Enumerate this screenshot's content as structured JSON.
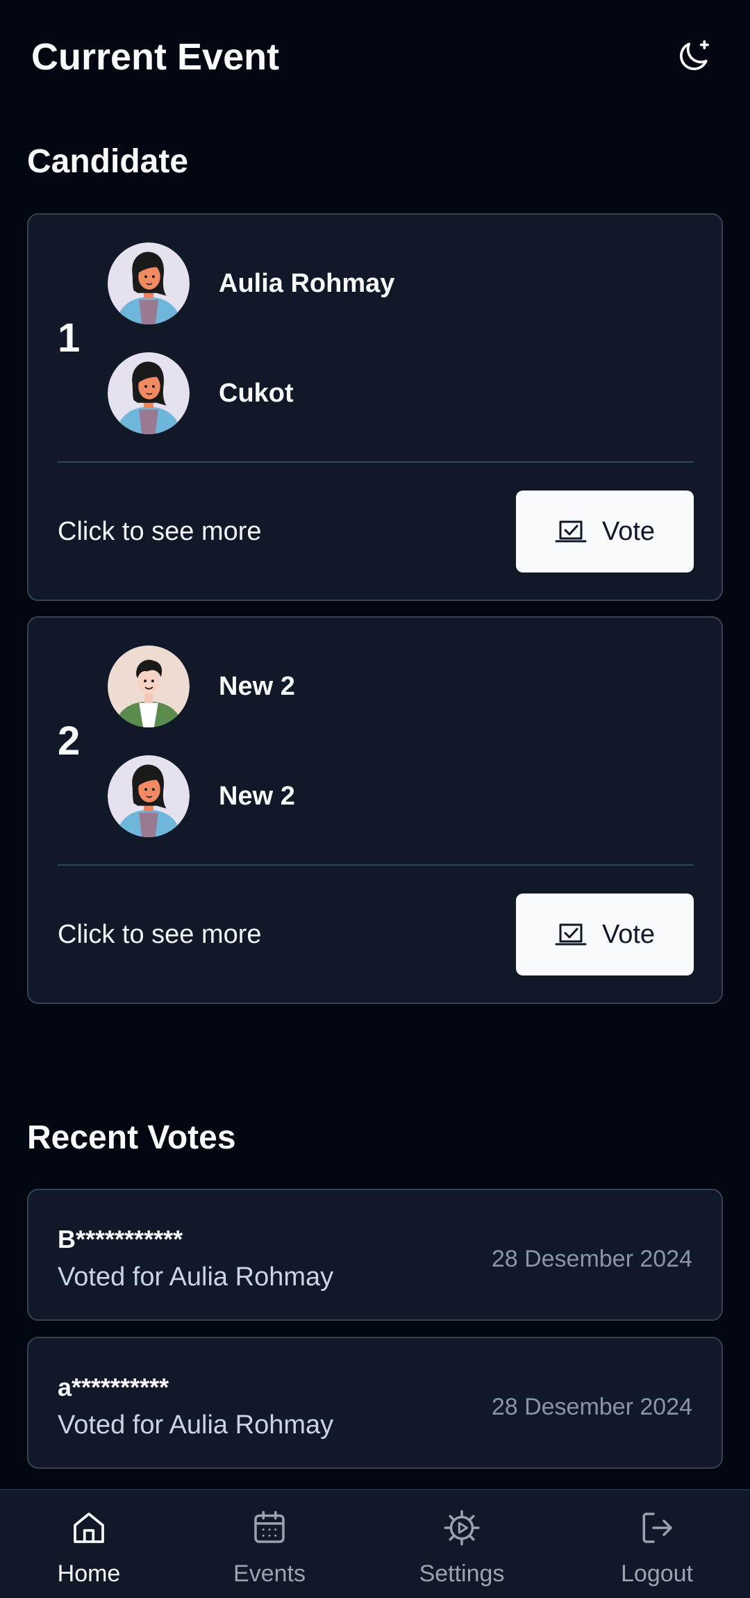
{
  "header": {
    "title": "Current Event",
    "theme_toggle_icon": "moon-star-icon"
  },
  "candidates_section": {
    "title": "Candidate",
    "cards": [
      {
        "number": "1",
        "members": [
          {
            "name": "Aulia Rohmay",
            "avatar": "female-avatar"
          },
          {
            "name": "Cukot",
            "avatar": "female-avatar"
          }
        ],
        "see_more": "Click to see more",
        "vote_label": "Vote",
        "vote_icon": "vote-check-icon"
      },
      {
        "number": "2",
        "members": [
          {
            "name": "New 2",
            "avatar": "male-avatar"
          },
          {
            "name": "New 2",
            "avatar": "female-avatar"
          }
        ],
        "see_more": "Click to see more",
        "vote_label": "Vote",
        "vote_icon": "vote-check-icon"
      }
    ]
  },
  "recent_votes": {
    "title": "Recent Votes",
    "items": [
      {
        "voter": "B***********",
        "voted_for": "Voted for Aulia Rohmay",
        "date": "28 Desember 2024"
      },
      {
        "voter": "a**********",
        "voted_for": "Voted for Aulia Rohmay",
        "date": "28 Desember 2024"
      }
    ]
  },
  "nav": {
    "active": "Home",
    "items": [
      {
        "label": "Home",
        "icon": "home-icon"
      },
      {
        "label": "Events",
        "icon": "calendar-icon"
      },
      {
        "label": "Settings",
        "icon": "gear-icon"
      },
      {
        "label": "Logout",
        "icon": "logout-icon"
      }
    ]
  },
  "colors": {
    "background": "#030712",
    "card": "#111827",
    "card_border": "#374151",
    "button_bg": "#f8fafc",
    "muted_text": "#8b95a5"
  }
}
